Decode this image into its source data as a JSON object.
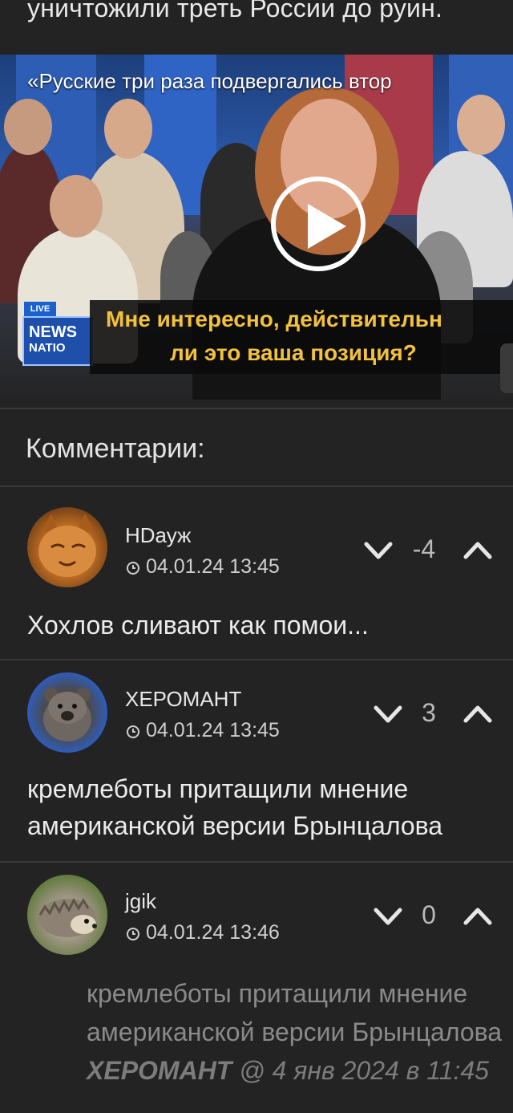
{
  "article": {
    "top_text": "уничтожили треть России до руин."
  },
  "video": {
    "caption_top": "«Русские три раза подвергались втор",
    "subtitle_line1": "Мне интересно, действительн",
    "subtitle_line2": "ли это ваша позиция?",
    "live_label": "LIVE",
    "logo_line1": "NEWS",
    "logo_line2": "NATIO"
  },
  "comments_section": {
    "title": "Комментарии:",
    "comments": [
      {
        "username": "HDауж",
        "timestamp": "04.01.24 13:45",
        "score": "-4",
        "text": "Хохлов сливают как помои...",
        "avatar": "orange-cat-avatar"
      },
      {
        "username": "ХЕРОМАНТ",
        "timestamp": "04.01.24 13:45",
        "score": "3",
        "text_line1": "кремлеботы притащили мнение",
        "text_line2": "американской версии Брынцалова",
        "avatar": "wombat-avatar"
      },
      {
        "username": "jgik",
        "timestamp": "04.01.24 13:46",
        "score": "0",
        "quote_line1": "кремлеботы притащили мнение",
        "quote_line2": "американской версии Брынцалова",
        "quote_author": "ХЕРОМАНТ",
        "quote_meta": "@ 4 янв 2024 в 11:45",
        "avatar": "hedgehog-avatar"
      }
    ]
  },
  "colors": {
    "background": "#232323",
    "divider": "#3a3a3a",
    "subtitle": "#f3c13a"
  }
}
